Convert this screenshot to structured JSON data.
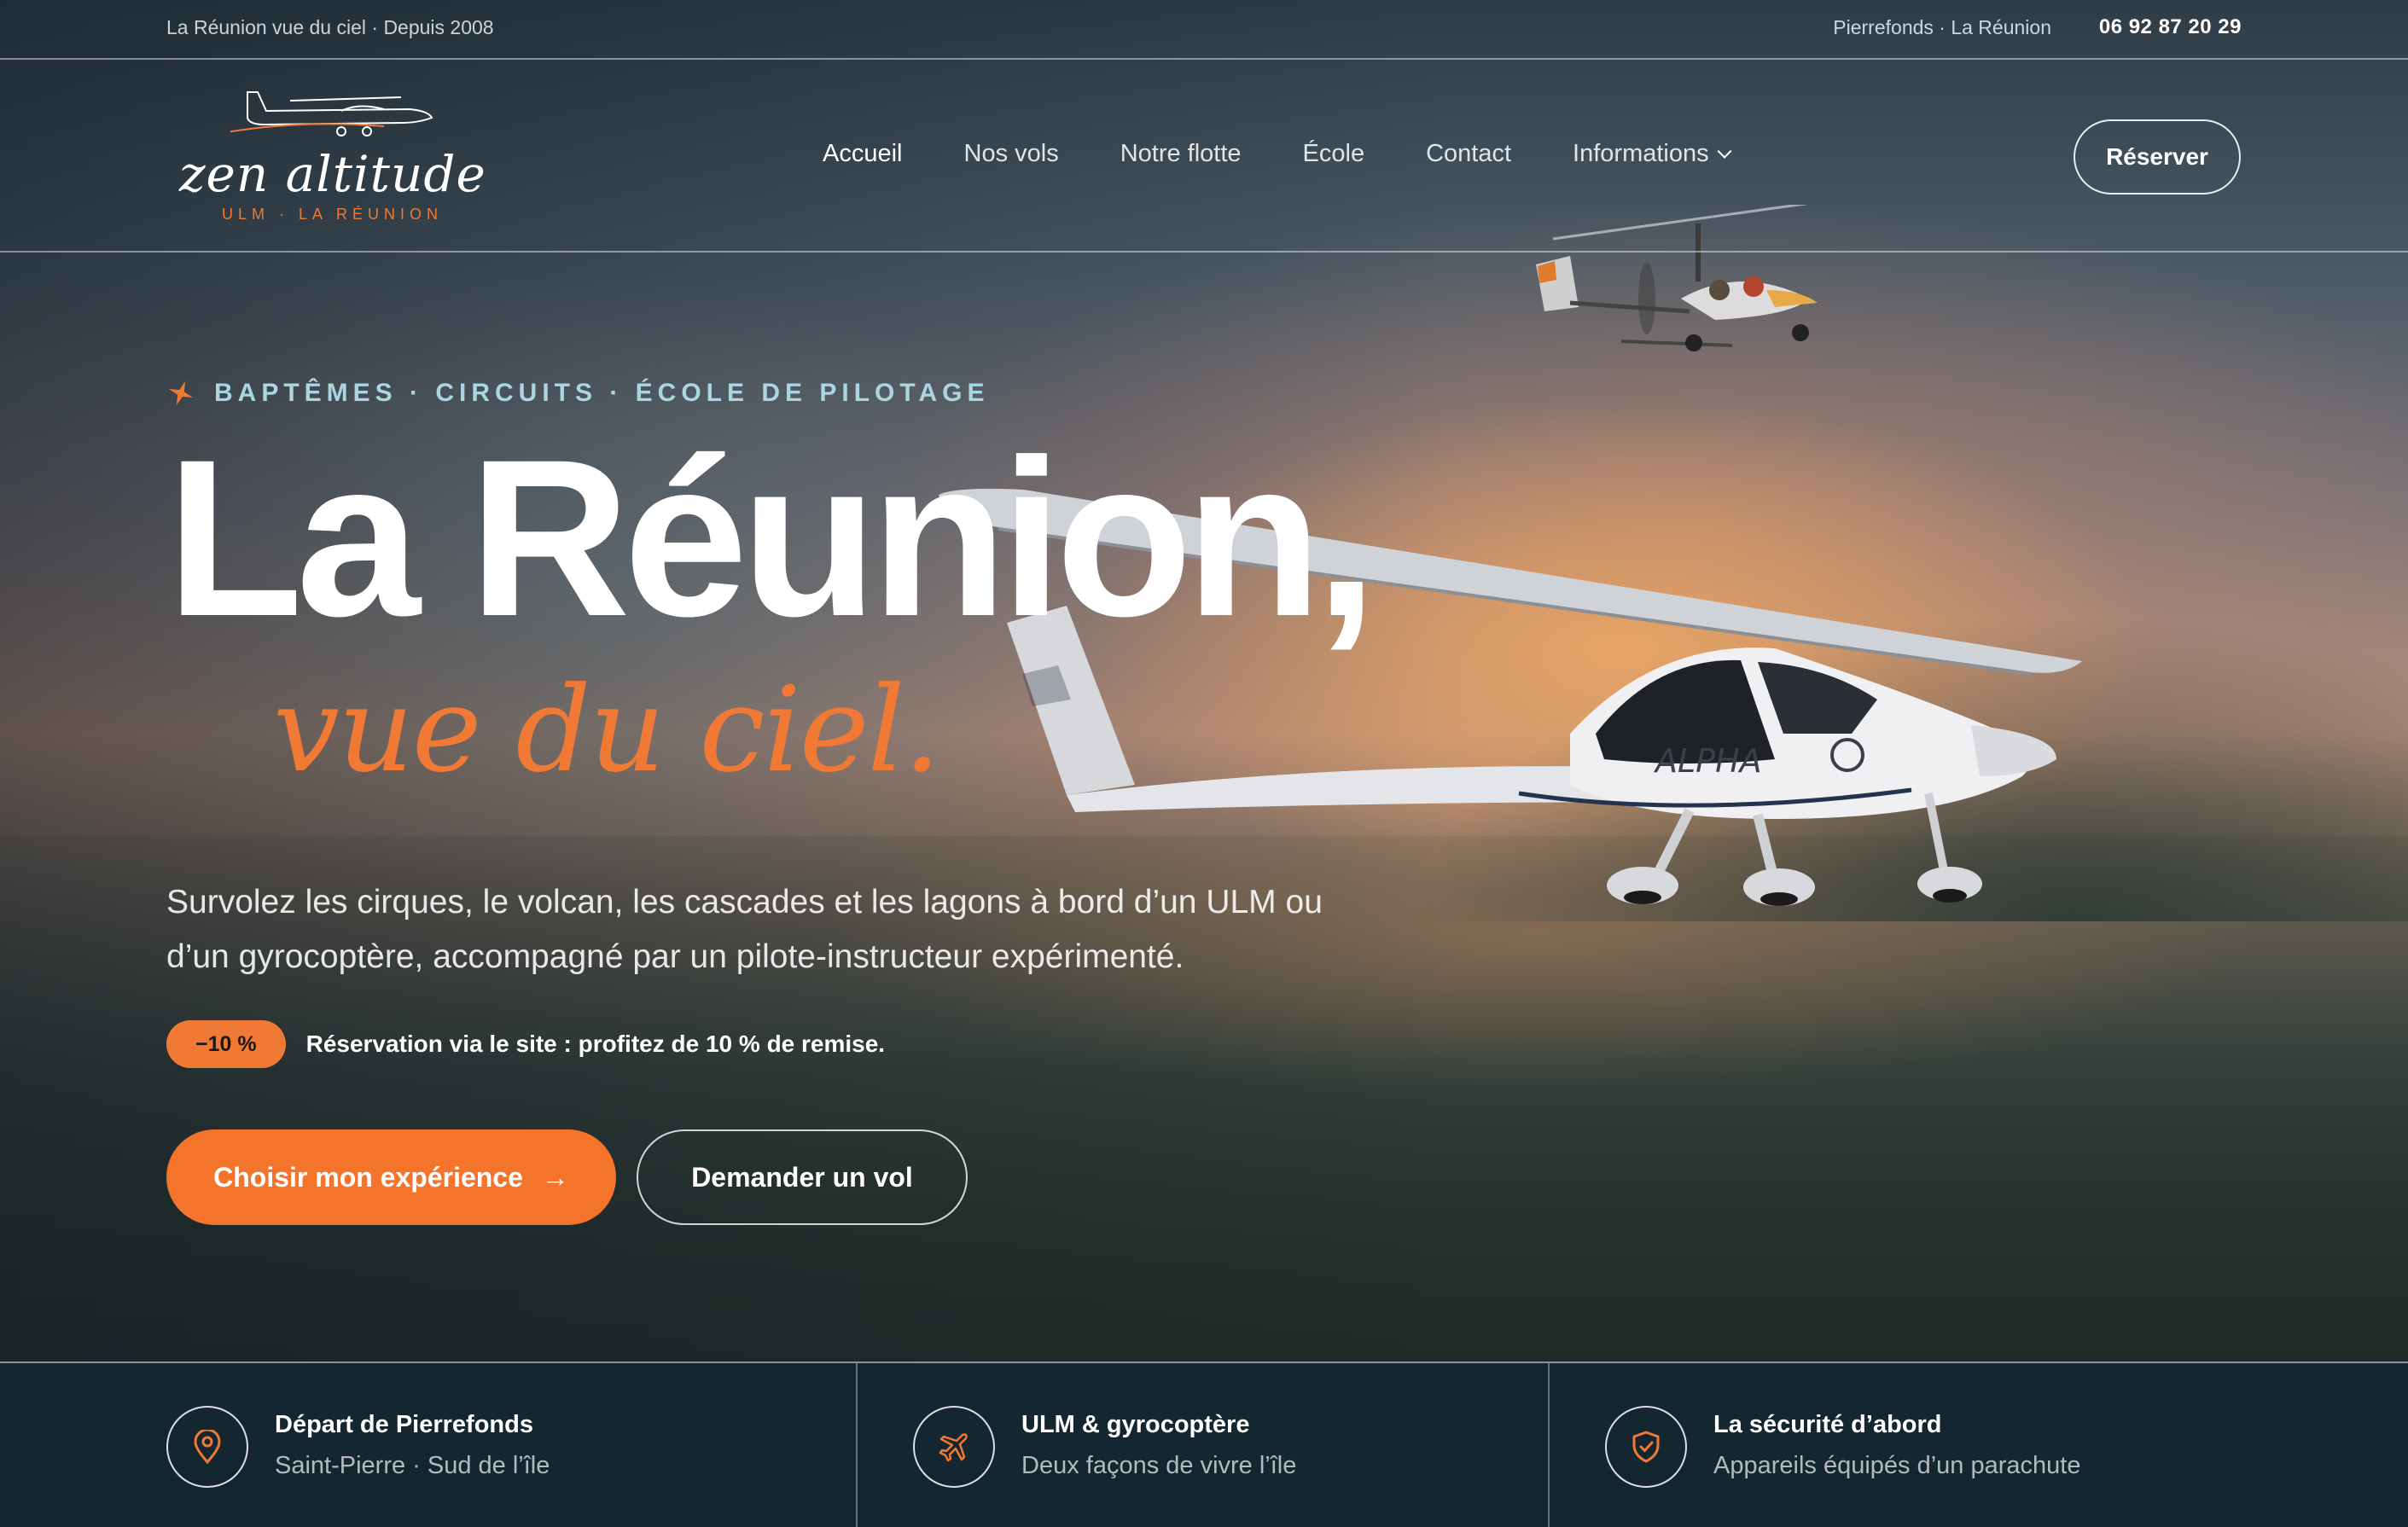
{
  "topbar": {
    "tagline": "La Réunion vue du ciel · Depuis 2008",
    "location": "Pierrefonds · La Réunion",
    "phone": "06 92 87 20 29"
  },
  "brand": {
    "name": "zen altitude",
    "subtitle": "ULM · LA RÉUNION",
    "accent_color": "#f07a35"
  },
  "nav": {
    "items": [
      {
        "label": "Accueil",
        "active": true
      },
      {
        "label": "Nos vols"
      },
      {
        "label": "Notre flotte"
      },
      {
        "label": "École"
      },
      {
        "label": "Contact"
      },
      {
        "label": "Informations",
        "has_dropdown": true
      }
    ],
    "cta_label": "Réserver"
  },
  "hero": {
    "eyebrow": "BAPTÊMES · CIRCUITS · ÉCOLE DE PILOTAGE",
    "eyebrow_icon": "airplane-icon",
    "title": "La Réunion,",
    "title_script": "vue du ciel.",
    "lead": "Survolez les cirques, le volcan, les cascades et les lagons à bord d’un ULM ou d’un gyrocoptère, accompagné par un pilote-instructeur expérimenté.",
    "promo_badge": "−10 %",
    "promo_text": "Réservation via le site : profitez de 10 % de remise.",
    "primary_cta": "Choisir mon expérience",
    "primary_cta_icon": "arrow-right-icon",
    "secondary_cta": "Demander un vol"
  },
  "features": [
    {
      "icon": "map-pin-icon",
      "title": "Départ de Pierrefonds",
      "desc": "Saint-Pierre · Sud de l’île"
    },
    {
      "icon": "plane-icon",
      "title": "ULM & gyrocoptère",
      "desc": "Deux façons de vivre l’île"
    },
    {
      "icon": "shield-check-icon",
      "title": "La sécurité d’abord",
      "desc": "Appareils équipés d’un parachute"
    }
  ]
}
